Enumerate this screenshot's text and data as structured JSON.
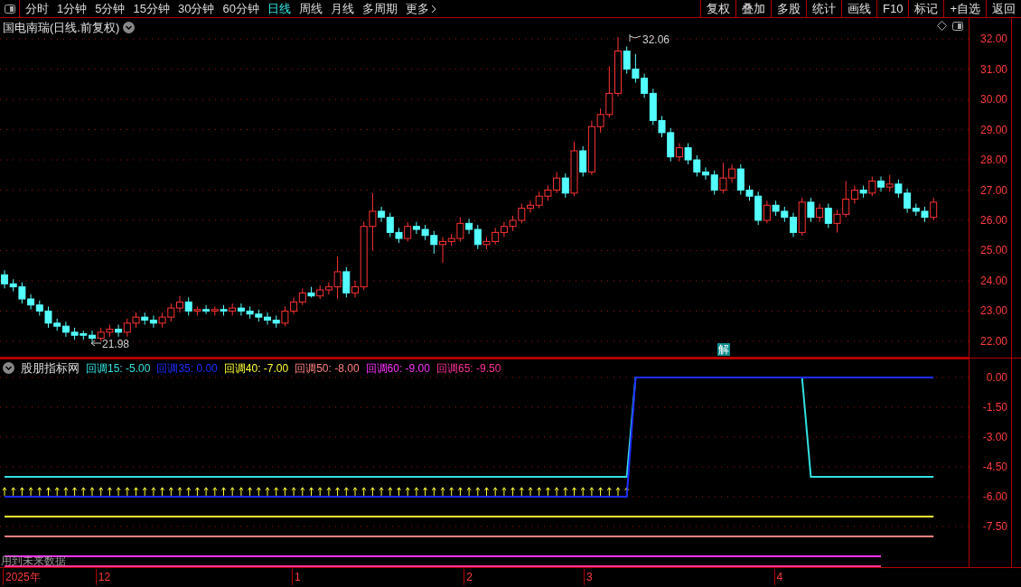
{
  "toolbar": {
    "periods": [
      {
        "label": "分时",
        "selected": false
      },
      {
        "label": "1分钟",
        "selected": false
      },
      {
        "label": "5分钟",
        "selected": false
      },
      {
        "label": "15分钟",
        "selected": false
      },
      {
        "label": "30分钟",
        "selected": false
      },
      {
        "label": "60分钟",
        "selected": false
      },
      {
        "label": "日线",
        "selected": true
      },
      {
        "label": "周线",
        "selected": false
      },
      {
        "label": "月线",
        "selected": false
      },
      {
        "label": "多周期",
        "selected": false
      }
    ],
    "more": "更多",
    "buttons": [
      "复权",
      "叠加",
      "多股",
      "统计",
      "画线",
      "F10",
      "标记",
      "+自选",
      "返回"
    ]
  },
  "price_chart": {
    "title": "国电南瑞(日线.前复权)",
    "high_label": "32.06",
    "low_label": "21.98",
    "badge": "解",
    "chart_data": {
      "type": "candlestick",
      "grid": true,
      "ylim": [
        21.46,
        32.69
      ],
      "yticks": [
        {
          "value": 32,
          "label": "32.00"
        },
        {
          "value": 31,
          "label": "31.00"
        },
        {
          "value": 30,
          "label": "30.00"
        },
        {
          "value": 29,
          "label": "29.00"
        },
        {
          "value": 28,
          "label": "28.00"
        },
        {
          "value": 27,
          "label": "27.00"
        },
        {
          "value": 26,
          "label": "26.00"
        },
        {
          "value": 25,
          "label": "25.00"
        },
        {
          "value": 24,
          "label": "24.00"
        },
        {
          "value": 23,
          "label": "23.00"
        },
        {
          "value": 22,
          "label": "22.00"
        }
      ],
      "ohlc": [
        [
          24.2,
          24.35,
          23.75,
          23.9
        ],
        [
          23.9,
          24.05,
          23.65,
          23.8
        ],
        [
          23.8,
          23.95,
          23.25,
          23.4
        ],
        [
          23.4,
          23.55,
          23.05,
          23.2
        ],
        [
          23.2,
          23.35,
          22.85,
          23.0
        ],
        [
          23.0,
          23.15,
          22.45,
          22.6
        ],
        [
          22.6,
          22.75,
          22.35,
          22.5
        ],
        [
          22.5,
          22.65,
          22.15,
          22.3
        ],
        [
          22.3,
          22.45,
          22.05,
          22.2
        ],
        [
          22.25,
          22.35,
          22.05,
          22.2
        ],
        [
          22.2,
          22.35,
          21.98,
          22.1
        ],
        [
          22.1,
          22.45,
          22.0,
          22.3
        ],
        [
          22.3,
          22.55,
          22.15,
          22.4
        ],
        [
          22.4,
          22.55,
          22.15,
          22.3
        ],
        [
          22.3,
          22.75,
          22.15,
          22.6
        ],
        [
          22.6,
          22.95,
          22.45,
          22.8
        ],
        [
          22.8,
          22.95,
          22.55,
          22.7
        ],
        [
          22.7,
          22.85,
          22.45,
          22.6
        ],
        [
          22.6,
          22.95,
          22.45,
          22.8
        ],
        [
          22.8,
          23.25,
          22.65,
          23.1
        ],
        [
          23.1,
          23.5,
          22.95,
          23.3
        ],
        [
          23.3,
          23.45,
          22.85,
          23.0
        ],
        [
          23.0,
          23.15,
          22.85,
          23.05
        ],
        [
          23.05,
          23.2,
          22.9,
          23.0
        ],
        [
          23.0,
          23.15,
          22.85,
          23.05
        ],
        [
          23.05,
          23.2,
          22.85,
          23.0
        ],
        [
          23.0,
          23.25,
          22.85,
          23.1
        ],
        [
          23.1,
          23.25,
          22.85,
          23.0
        ],
        [
          23.0,
          23.15,
          22.75,
          22.9
        ],
        [
          22.9,
          23.05,
          22.65,
          22.8
        ],
        [
          22.8,
          22.95,
          22.55,
          22.7
        ],
        [
          22.7,
          22.85,
          22.45,
          22.6
        ],
        [
          22.6,
          23.15,
          22.5,
          23.0
        ],
        [
          23.0,
          23.45,
          22.9,
          23.3
        ],
        [
          23.3,
          23.75,
          23.2,
          23.6
        ],
        [
          23.6,
          23.8,
          23.45,
          23.5
        ],
        [
          23.5,
          23.85,
          23.4,
          23.7
        ],
        [
          23.7,
          23.95,
          23.55,
          23.8
        ],
        [
          23.8,
          24.8,
          23.4,
          24.3
        ],
        [
          24.3,
          24.45,
          23.45,
          23.6
        ],
        [
          23.6,
          24.0,
          23.45,
          23.8
        ],
        [
          23.8,
          25.95,
          23.7,
          25.8
        ],
        [
          25.8,
          26.9,
          25.0,
          26.3
        ],
        [
          26.3,
          26.45,
          25.95,
          26.1
        ],
        [
          26.1,
          26.25,
          25.45,
          25.6
        ],
        [
          25.6,
          25.75,
          25.25,
          25.4
        ],
        [
          25.4,
          25.95,
          25.3,
          25.8
        ],
        [
          25.8,
          25.95,
          25.55,
          25.7
        ],
        [
          25.7,
          25.85,
          25.35,
          25.5
        ],
        [
          25.5,
          25.65,
          24.9,
          25.2
        ],
        [
          25.2,
          25.45,
          24.6,
          25.3
        ],
        [
          25.3,
          25.55,
          25.15,
          25.4
        ],
        [
          25.4,
          26.1,
          25.3,
          25.9
        ],
        [
          25.9,
          26.05,
          25.55,
          25.7
        ],
        [
          25.7,
          25.85,
          25.05,
          25.2
        ],
        [
          25.2,
          25.45,
          25.05,
          25.3
        ],
        [
          25.3,
          25.75,
          25.2,
          25.6
        ],
        [
          25.6,
          25.95,
          25.45,
          25.8
        ],
        [
          25.8,
          26.15,
          25.65,
          26.0
        ],
        [
          26.0,
          26.55,
          25.9,
          26.4
        ],
        [
          26.4,
          26.65,
          26.25,
          26.5
        ],
        [
          26.5,
          26.95,
          26.4,
          26.8
        ],
        [
          26.8,
          27.15,
          26.65,
          27.0
        ],
        [
          27.0,
          27.6,
          26.9,
          27.4
        ],
        [
          27.4,
          27.55,
          26.75,
          26.9
        ],
        [
          26.9,
          28.6,
          26.8,
          28.3
        ],
        [
          28.3,
          28.45,
          27.45,
          27.6
        ],
        [
          27.6,
          29.3,
          27.5,
          29.1
        ],
        [
          29.1,
          29.7,
          28.9,
          29.5
        ],
        [
          29.5,
          31.1,
          29.4,
          30.2
        ],
        [
          30.2,
          32.06,
          30.1,
          31.6
        ],
        [
          31.6,
          31.75,
          30.85,
          31.0
        ],
        [
          31.0,
          31.5,
          30.55,
          30.7
        ],
        [
          30.7,
          30.85,
          30.05,
          30.2
        ],
        [
          30.2,
          30.35,
          29.15,
          29.3
        ],
        [
          29.3,
          29.45,
          28.75,
          28.9
        ],
        [
          28.9,
          29.05,
          27.95,
          28.1
        ],
        [
          28.1,
          28.55,
          27.95,
          28.4
        ],
        [
          28.4,
          28.55,
          27.85,
          28.0
        ],
        [
          28.0,
          28.15,
          27.45,
          27.6
        ],
        [
          27.6,
          27.75,
          27.35,
          27.5
        ],
        [
          27.5,
          27.65,
          26.85,
          27.0
        ],
        [
          27.0,
          27.9,
          26.9,
          27.4
        ],
        [
          27.4,
          27.85,
          27.25,
          27.7
        ],
        [
          27.7,
          27.85,
          26.85,
          27.0
        ],
        [
          27.0,
          27.15,
          26.65,
          26.8
        ],
        [
          26.8,
          26.95,
          25.85,
          26.0
        ],
        [
          26.0,
          26.65,
          25.9,
          26.5
        ],
        [
          26.5,
          26.65,
          26.15,
          26.3
        ],
        [
          26.3,
          26.45,
          25.95,
          26.1
        ],
        [
          26.1,
          26.25,
          25.45,
          25.6
        ],
        [
          25.6,
          26.75,
          25.5,
          26.6
        ],
        [
          26.6,
          26.75,
          25.95,
          26.1
        ],
        [
          26.1,
          26.55,
          25.95,
          26.4
        ],
        [
          26.4,
          26.55,
          25.75,
          25.9
        ],
        [
          25.9,
          26.35,
          25.6,
          26.2
        ],
        [
          26.2,
          27.3,
          26.1,
          26.7
        ],
        [
          26.7,
          27.15,
          26.55,
          27.0
        ],
        [
          27.0,
          27.15,
          26.75,
          26.9
        ],
        [
          26.9,
          27.45,
          26.8,
          27.3
        ],
        [
          27.3,
          27.45,
          26.95,
          27.1
        ],
        [
          27.1,
          27.5,
          26.95,
          27.2
        ],
        [
          27.2,
          27.35,
          26.75,
          26.9
        ],
        [
          26.9,
          27.05,
          26.25,
          26.4
        ],
        [
          26.4,
          26.55,
          26.15,
          26.3
        ],
        [
          26.3,
          26.45,
          25.95,
          26.1
        ],
        [
          26.1,
          26.75,
          26.0,
          26.6
        ]
      ]
    }
  },
  "indicator": {
    "name": "股朋指标网",
    "warning": "用到未来数据",
    "legend_values": [
      ": -5.00",
      ": 0.00",
      ": -7.00",
      ": -8.00",
      ": -9.00",
      ": -9.50"
    ],
    "chart_data": {
      "type": "line",
      "grid": true,
      "ylim": [
        -9.55,
        0.95
      ],
      "yticks": [
        {
          "value": 0,
          "label": "0.00"
        },
        {
          "value": -1.5,
          "label": "-1.50"
        },
        {
          "value": -3,
          "label": "-3.00"
        },
        {
          "value": -4.5,
          "label": "-4.50"
        },
        {
          "value": -6,
          "label": "-6.00"
        },
        {
          "value": -7.5,
          "label": "-7.50"
        }
      ],
      "series": [
        {
          "name": "回调15",
          "color": "#33e0e0",
          "values": [
            -5,
            -5,
            -5,
            -5,
            -5,
            -5,
            -5,
            -5,
            -5,
            -5,
            -5,
            -5,
            -5,
            -5,
            -5,
            -5,
            -5,
            -5,
            -5,
            -5,
            -5,
            -5,
            -5,
            -5,
            -5,
            -5,
            -5,
            -5,
            -5,
            -5,
            -5,
            -5,
            -5,
            -5,
            -5,
            -5,
            -5,
            -5,
            -5,
            -5,
            -5,
            -5,
            -5,
            -5,
            -5,
            -5,
            -5,
            -5,
            -5,
            -5,
            -5,
            -5,
            -5,
            -5,
            -5,
            -5,
            -5,
            -5,
            -5,
            -5,
            -5,
            -5,
            -5,
            -5,
            -5,
            -5,
            -5,
            -5,
            -5,
            -5,
            -5,
            -5,
            0,
            0,
            0,
            0,
            0,
            0,
            0,
            0,
            0,
            0,
            0,
            0,
            0,
            0,
            0,
            0,
            0,
            0,
            0,
            0,
            -5,
            -5,
            -5,
            -5,
            -5,
            -5,
            -5,
            -5,
            -5,
            -5,
            -5,
            -5,
            -5,
            -5,
            -5
          ]
        },
        {
          "name": "回调35",
          "color": "#1f2cff",
          "values": [
            -6,
            -6,
            -6,
            -6,
            -6,
            -6,
            -6,
            -6,
            -6,
            -6,
            -6,
            -6,
            -6,
            -6,
            -6,
            -6,
            -6,
            -6,
            -6,
            -6,
            -6,
            -6,
            -6,
            -6,
            -6,
            -6,
            -6,
            -6,
            -6,
            -6,
            -6,
            -6,
            -6,
            -6,
            -6,
            -6,
            -6,
            -6,
            -6,
            -6,
            -6,
            -6,
            -6,
            -6,
            -6,
            -6,
            -6,
            -6,
            -6,
            -6,
            -6,
            -6,
            -6,
            -6,
            -6,
            -6,
            -6,
            -6,
            -6,
            -6,
            -6,
            -6,
            -6,
            -6,
            -6,
            -6,
            -6,
            -6,
            -6,
            -6,
            -6,
            -6,
            0,
            0,
            0,
            0,
            0,
            0,
            0,
            0,
            0,
            0,
            0,
            0,
            0,
            0,
            0,
            0,
            0,
            0,
            0,
            0,
            0,
            0,
            0,
            0,
            0,
            0,
            0,
            0,
            0,
            0,
            0,
            0,
            0,
            0,
            0
          ]
        },
        {
          "name": "回调40",
          "color": "#ffff33",
          "values": [
            -7,
            -7,
            -7,
            -7,
            -7,
            -7,
            -7,
            -7,
            -7,
            -7,
            -7,
            -7,
            -7,
            -7,
            -7,
            -7,
            -7,
            -7,
            -7,
            -7,
            -7,
            -7,
            -7,
            -7,
            -7,
            -7,
            -7,
            -7,
            -7,
            -7,
            -7,
            -7,
            -7,
            -7,
            -7,
            -7,
            -7,
            -7,
            -7,
            -7,
            -7,
            -7,
            -7,
            -7,
            -7,
            -7,
            -7,
            -7,
            -7,
            -7,
            -7,
            -7,
            -7,
            -7,
            -7,
            -7,
            -7,
            -7,
            -7,
            -7,
            -7,
            -7,
            -7,
            -7,
            -7,
            -7,
            -7,
            -7,
            -7,
            -7,
            -7,
            -7,
            -7,
            -7,
            -7,
            -7,
            -7,
            -7,
            -7,
            -7,
            -7,
            -7,
            -7,
            -7,
            -7,
            -7,
            -7,
            -7,
            -7,
            -7,
            -7,
            -7,
            -7,
            -7,
            -7,
            -7,
            -7,
            -7,
            -7,
            -7,
            -7,
            -7,
            -7,
            -7,
            -7,
            -7,
            -7
          ]
        },
        {
          "name": "回调50",
          "color": "#ff8080",
          "values": [
            -8,
            -8,
            -8,
            -8,
            -8,
            -8,
            -8,
            -8,
            -8,
            -8,
            -8,
            -8,
            -8,
            -8,
            -8,
            -8,
            -8,
            -8,
            -8,
            -8,
            -8,
            -8,
            -8,
            -8,
            -8,
            -8,
            -8,
            -8,
            -8,
            -8,
            -8,
            -8,
            -8,
            -8,
            -8,
            -8,
            -8,
            -8,
            -8,
            -8,
            -8,
            -8,
            -8,
            -8,
            -8,
            -8,
            -8,
            -8,
            -8,
            -8,
            -8,
            -8,
            -8,
            -8,
            -8,
            -8,
            -8,
            -8,
            -8,
            -8,
            -8,
            -8,
            -8,
            -8,
            -8,
            -8,
            -8,
            -8,
            -8,
            -8,
            -8,
            -8,
            -8,
            -8,
            -8,
            -8,
            -8,
            -8,
            -8,
            -8,
            -8,
            -8,
            -8,
            -8,
            -8,
            -8,
            -8,
            -8,
            -8,
            -8,
            -8,
            -8,
            -8,
            -8,
            -8,
            -8,
            -8,
            -8,
            -8,
            -8,
            -8,
            -8,
            -8,
            -8,
            -8,
            -8,
            -8
          ]
        },
        {
          "name": "回调60",
          "color": "#ff33ff",
          "values": [
            -9,
            -9,
            -9,
            -9,
            -9,
            -9,
            -9,
            -9,
            -9,
            -9,
            -9,
            -9,
            -9,
            -9,
            -9,
            -9,
            -9,
            -9,
            -9,
            -9,
            -9,
            -9,
            -9,
            -9,
            -9,
            -9,
            -9,
            -9,
            -9,
            -9,
            -9,
            -9,
            -9,
            -9,
            -9,
            -9,
            -9,
            -9,
            -9,
            -9,
            -9,
            -9,
            -9,
            -9,
            -9,
            -9,
            -9,
            -9,
            -9,
            -9,
            -9,
            -9,
            -9,
            -9,
            -9,
            -9,
            -9,
            -9,
            -9,
            -9,
            -9,
            -9,
            -9,
            -9,
            -9,
            -9,
            -9,
            -9,
            -9,
            -9,
            -9,
            -9,
            -9,
            -9,
            -9,
            -9,
            -9,
            -9,
            -9,
            -9,
            -9,
            -9,
            -9,
            -9,
            -9,
            -9,
            -9,
            -9,
            -9,
            -9,
            -9,
            -9,
            -9,
            -9,
            -9,
            -9,
            -9,
            -9,
            -9,
            -9,
            -9,
            null,
            null,
            null,
            null,
            null,
            null
          ]
        },
        {
          "name": "回调65",
          "color": "#ff3399",
          "values": [
            -9.5,
            -9.5,
            -9.5,
            -9.5,
            -9.5,
            -9.5,
            -9.5,
            -9.5,
            -9.5,
            -9.5,
            -9.5,
            -9.5,
            -9.5,
            -9.5,
            -9.5,
            -9.5,
            -9.5,
            -9.5,
            -9.5,
            -9.5,
            -9.5,
            -9.5,
            -9.5,
            -9.5,
            -9.5,
            -9.5,
            -9.5,
            -9.5,
            -9.5,
            -9.5,
            -9.5,
            -9.5,
            -9.5,
            -9.5,
            -9.5,
            -9.5,
            -9.5,
            -9.5,
            -9.5,
            -9.5,
            -9.5,
            -9.5,
            -9.5,
            -9.5,
            -9.5,
            -9.5,
            -9.5,
            -9.5,
            -9.5,
            -9.5,
            -9.5,
            -9.5,
            -9.5,
            -9.5,
            -9.5,
            -9.5,
            -9.5,
            -9.5,
            -9.5,
            -9.5,
            -9.5,
            -9.5,
            -9.5,
            -9.5,
            -9.5,
            -9.5,
            -9.5,
            -9.5,
            -9.5,
            -9.5,
            -9.5,
            -9.5,
            -9.5,
            -9.5,
            -9.5,
            -9.5,
            -9.5,
            -9.5,
            -9.5,
            -9.5,
            -9.5,
            -9.5,
            -9.5,
            -9.5,
            -9.5,
            -9.5,
            -9.5,
            -9.5,
            -9.5,
            -9.5,
            -9.5,
            -9.5,
            -9.5,
            -9.5,
            -9.5,
            -9.5,
            -9.5,
            -9.5,
            -9.5,
            -9.5,
            -9.5,
            null,
            null,
            null,
            null,
            null,
            null
          ]
        }
      ]
    }
  },
  "date_axis": [
    "2025年",
    "12",
    "1",
    "2",
    "3",
    "4"
  ]
}
